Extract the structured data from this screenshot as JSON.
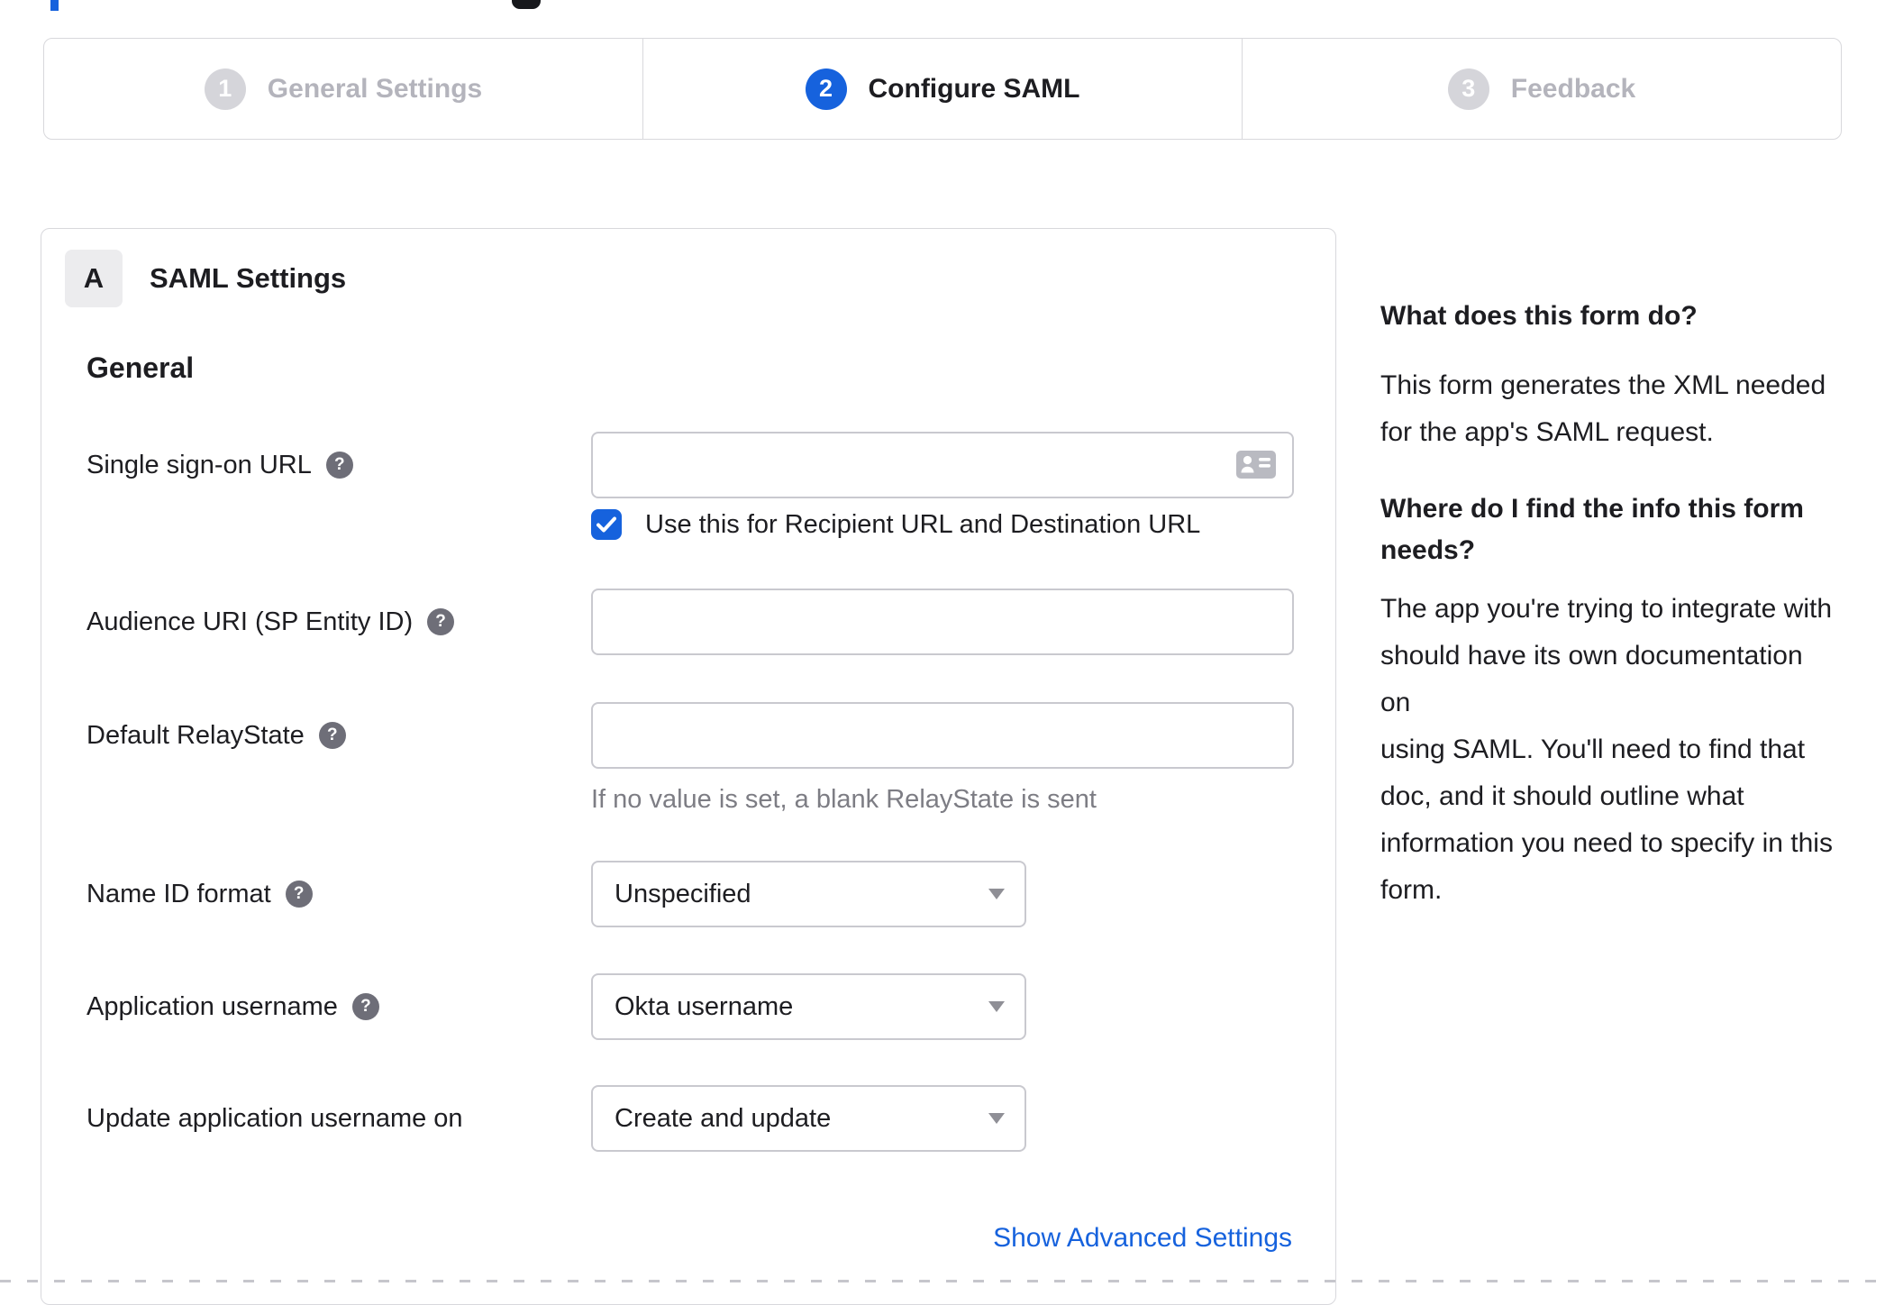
{
  "colors": {
    "primary_blue": "#1662dd",
    "text_dark": "#1d1d21",
    "inactive_gray": "#b4b4bc",
    "hint_gray": "#7d7d84",
    "border_gray": "#d8d8dc"
  },
  "artifacts": {
    "top_left_fragment": "blue-bar-fragment",
    "top_center_fragment": "dark-logo-fragment"
  },
  "stepper": {
    "active_step": "2",
    "steps": [
      {
        "number": "1",
        "label": "General Settings"
      },
      {
        "number": "2",
        "label": "Configure SAML"
      },
      {
        "number": "3",
        "label": "Feedback"
      }
    ]
  },
  "saml_panel": {
    "badge": "A",
    "title": "SAML Settings",
    "section_heading": "General",
    "sso_url": {
      "label": "Single sign-on URL",
      "value": "",
      "help_icon": "question-mark-icon",
      "trailing_icon": "address-card-icon"
    },
    "sso_checkbox": {
      "checked": true,
      "label": "Use this for Recipient URL and Destination URL"
    },
    "audience_uri": {
      "label": "Audience URI (SP Entity ID)",
      "value": "",
      "help_icon": "question-mark-icon"
    },
    "default_relaystate": {
      "label": "Default RelayState",
      "value": "",
      "help_icon": "question-mark-icon",
      "hint": "If no value is set, a blank RelayState is sent"
    },
    "name_id_format": {
      "label": "Name ID format",
      "help_icon": "question-mark-icon",
      "value": "Unspecified"
    },
    "application_username": {
      "label": "Application username",
      "help_icon": "question-mark-icon",
      "value": "Okta username"
    },
    "update_app_username": {
      "label": "Update application username on",
      "value": "Create and update"
    },
    "advanced_link": "Show Advanced Settings"
  },
  "help_sidebar": {
    "q1_heading": "What does this form do?",
    "q1_body": [
      "This form generates the XML needed",
      "for the app's SAML request."
    ],
    "q2_heading": [
      "Where do I find the info this form",
      "needs?"
    ],
    "q2_body": [
      "The app you're trying to integrate with",
      "should have its own documentation on",
      "using SAML. You'll need to find that",
      "doc, and it should outline what",
      "information you need to specify in this",
      "form."
    ]
  }
}
